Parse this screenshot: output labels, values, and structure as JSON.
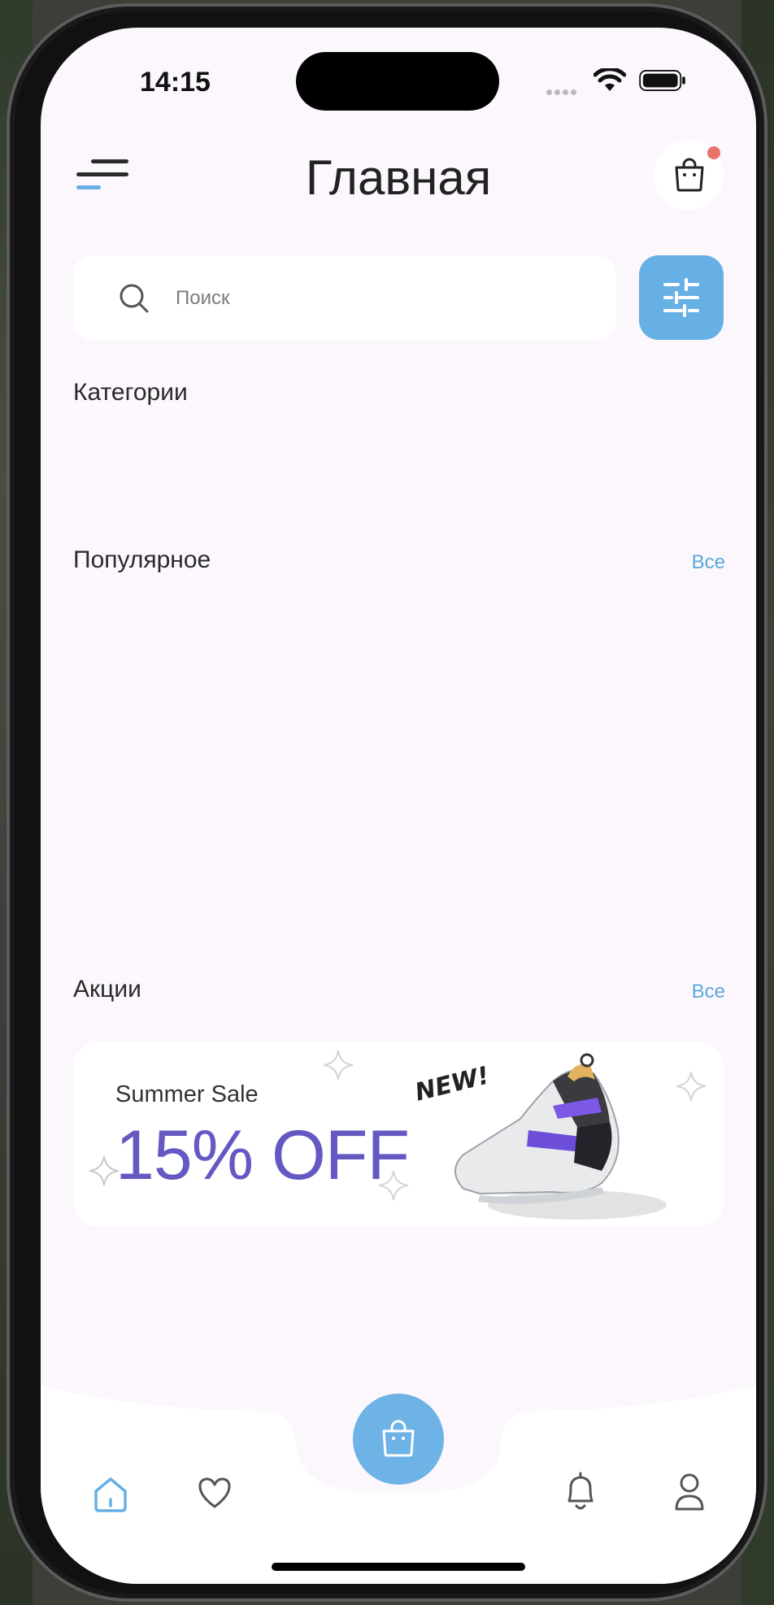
{
  "status_bar": {
    "time": "14:15"
  },
  "header": {
    "title": "Главная"
  },
  "search": {
    "placeholder": "Поиск"
  },
  "sections": {
    "categories": {
      "title": "Категории"
    },
    "popular": {
      "title": "Популярное",
      "see_all": "Все"
    },
    "promotions": {
      "title": "Акции",
      "see_all": "Все"
    }
  },
  "promo_banner": {
    "subtitle": "Summer Sale",
    "headline": "15% OFF",
    "sticker": "NEW!",
    "accent_color": "#6459c2"
  },
  "colors": {
    "accent": "#67b0e5",
    "background": "#fcf7fd",
    "notification_dot": "#ea7268"
  },
  "tab_bar": {
    "items": [
      {
        "icon": "home-icon",
        "active": true
      },
      {
        "icon": "heart-icon",
        "active": false
      },
      {
        "icon": "shopping-bag-icon",
        "active": false
      },
      {
        "icon": "bell-icon",
        "active": false
      },
      {
        "icon": "user-icon",
        "active": false
      }
    ]
  }
}
